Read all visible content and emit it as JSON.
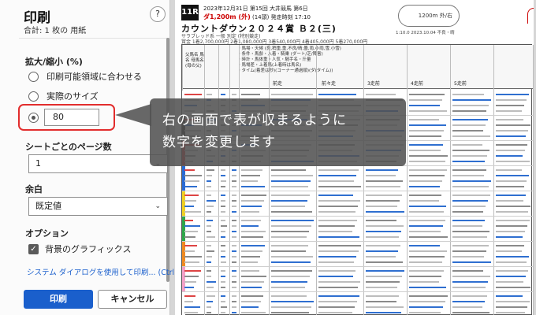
{
  "dialog": {
    "title": "印刷",
    "subtitle": "合計: 1 枚の 用紙",
    "help_label": "?",
    "scale_section": {
      "label": "拡大/縮小 (%)",
      "options": [
        {
          "label": "印刷可能領域に合わせる",
          "checked": false
        },
        {
          "label": "実際のサイズ",
          "checked": false
        }
      ],
      "custom_value": "80"
    },
    "pages_per_sheet": {
      "label": "シートごとのページ数",
      "value": "1"
    },
    "margins": {
      "label": "余白",
      "value": "既定値"
    },
    "options": {
      "label": "オプション",
      "background_graphics": {
        "label": "背景のグラフィックス",
        "checked": true
      }
    },
    "system_link": "システム ダイアログを使用して印刷... (Ctrl+Shift+P)",
    "buttons": {
      "print": "印刷",
      "cancel": "キャンセル"
    },
    "chevron": "⌄",
    "check_mark": "✓"
  },
  "callout": {
    "line1": "右の画面で表が収まるように",
    "line2": "数字を変更します"
  },
  "preview": {
    "race_number": "11R",
    "header_line1": "2023年12月31日 第15回 大井競馬 第6日",
    "distance": "ダ1,200m (外)",
    "header_line2_rest": "(14頭)  発走時刻 17:10",
    "race_name": "カウントダウン２０２４賞 Ｂ２(三)",
    "race_sub": "サラブレッド系 一般 別定 (特別競走)",
    "prize": "賞金 1着2,700,000円 2着1,080,000円 3着540,000円 4着405,000円 5着270,000円",
    "course": "1200m 外/右",
    "header_right": "1:10.0 2023.10.04 不良・晴",
    "columns": {
      "horse": "父馬名 馬名 母馬名(母の父)",
      "prev1": "前走",
      "prev2": "前々走",
      "prev3": "3走前",
      "prev4": "4走前",
      "prev5": "5走前"
    },
    "notes": [
      "・馬場・天候 (良,稍重,重,不良/晴,曇,雨,小雨,雪,小雪)",
      "・条件・馬齢・入着・騎乗 (ダート/芝/障害)",
      "・時計・馬体重・人気・騎手名・斤量",
      "・馬場差・上着馬(上着時は馬名)",
      "・タイム(着差は秒)(コーナー通過順)(ダ(タイム))"
    ]
  }
}
